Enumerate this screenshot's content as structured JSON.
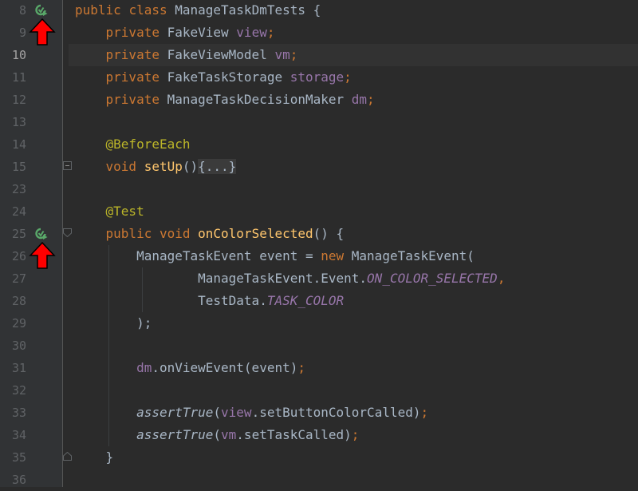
{
  "editor": {
    "lines": [
      {
        "num": "8",
        "tokens": [
          {
            "t": "public ",
            "c": "kw"
          },
          {
            "t": "class ",
            "c": "kw"
          },
          {
            "t": "ManageTaskDmTests {",
            "c": ""
          }
        ]
      },
      {
        "num": "9",
        "tokens": [
          {
            "t": "    ",
            "c": ""
          },
          {
            "t": "private ",
            "c": "kw"
          },
          {
            "t": "FakeView ",
            "c": ""
          },
          {
            "t": "view",
            "c": "fld"
          },
          {
            "t": ";",
            "c": "kw"
          }
        ]
      },
      {
        "num": "10",
        "tokens": [
          {
            "t": "    ",
            "c": ""
          },
          {
            "t": "private ",
            "c": "kw"
          },
          {
            "t": "FakeViewModel ",
            "c": ""
          },
          {
            "t": "vm",
            "c": "fld"
          },
          {
            "t": ";",
            "c": "kw"
          }
        ]
      },
      {
        "num": "11",
        "tokens": [
          {
            "t": "    ",
            "c": ""
          },
          {
            "t": "private ",
            "c": "kw"
          },
          {
            "t": "FakeTaskStorage ",
            "c": ""
          },
          {
            "t": "storage",
            "c": "fld"
          },
          {
            "t": ";",
            "c": "kw"
          }
        ]
      },
      {
        "num": "12",
        "tokens": [
          {
            "t": "    ",
            "c": ""
          },
          {
            "t": "private ",
            "c": "kw"
          },
          {
            "t": "ManageTaskDecisionMaker ",
            "c": ""
          },
          {
            "t": "dm",
            "c": "fld"
          },
          {
            "t": ";",
            "c": "kw"
          }
        ]
      },
      {
        "num": "13",
        "tokens": []
      },
      {
        "num": "14",
        "tokens": [
          {
            "t": "    ",
            "c": ""
          },
          {
            "t": "@BeforeEach",
            "c": "ann"
          }
        ]
      },
      {
        "num": "15",
        "tokens": [
          {
            "t": "    ",
            "c": ""
          },
          {
            "t": "void ",
            "c": "kw"
          },
          {
            "t": "setUp",
            "c": "fn"
          },
          {
            "t": "()",
            "c": ""
          },
          {
            "t": "{...}",
            "c": "fold-text"
          }
        ]
      },
      {
        "num": "23",
        "tokens": []
      },
      {
        "num": "24",
        "tokens": [
          {
            "t": "    ",
            "c": ""
          },
          {
            "t": "@Test",
            "c": "ann"
          }
        ]
      },
      {
        "num": "25",
        "tokens": [
          {
            "t": "    ",
            "c": ""
          },
          {
            "t": "public ",
            "c": "kw"
          },
          {
            "t": "void ",
            "c": "kw"
          },
          {
            "t": "onColorSelected",
            "c": "fn"
          },
          {
            "t": "() {",
            "c": ""
          }
        ]
      },
      {
        "num": "26",
        "tokens": [
          {
            "t": "        ManageTaskEvent event = ",
            "c": ""
          },
          {
            "t": "new ",
            "c": "kw"
          },
          {
            "t": "ManageTaskEvent(",
            "c": ""
          }
        ]
      },
      {
        "num": "27",
        "tokens": [
          {
            "t": "                ManageTaskEvent.Event.",
            "c": ""
          },
          {
            "t": "ON_COLOR_SELECTED",
            "c": "stat"
          },
          {
            "t": ",",
            "c": "kw"
          }
        ]
      },
      {
        "num": "28",
        "tokens": [
          {
            "t": "                TestData.",
            "c": ""
          },
          {
            "t": "TASK_COLOR",
            "c": "stat"
          }
        ]
      },
      {
        "num": "29",
        "tokens": [
          {
            "t": "        );",
            "c": ""
          }
        ]
      },
      {
        "num": "30",
        "tokens": []
      },
      {
        "num": "31",
        "tokens": [
          {
            "t": "        ",
            "c": ""
          },
          {
            "t": "dm",
            "c": "fld"
          },
          {
            "t": ".onViewEvent(event)",
            "c": ""
          },
          {
            "t": ";",
            "c": "kw"
          }
        ]
      },
      {
        "num": "32",
        "tokens": []
      },
      {
        "num": "33",
        "tokens": [
          {
            "t": "        ",
            "c": ""
          },
          {
            "t": "assertTrue",
            "c": "it"
          },
          {
            "t": "(",
            "c": ""
          },
          {
            "t": "view",
            "c": "fld"
          },
          {
            "t": ".setButtonColorCalled)",
            "c": ""
          },
          {
            "t": ";",
            "c": "kw"
          }
        ]
      },
      {
        "num": "34",
        "tokens": [
          {
            "t": "        ",
            "c": ""
          },
          {
            "t": "assertTrue",
            "c": "it"
          },
          {
            "t": "(",
            "c": ""
          },
          {
            "t": "vm",
            "c": "fld"
          },
          {
            "t": ".setTaskCalled)",
            "c": ""
          },
          {
            "t": ";",
            "c": "kw"
          }
        ]
      },
      {
        "num": "35",
        "tokens": [
          {
            "t": "    }",
            "c": ""
          }
        ]
      },
      {
        "num": "36",
        "tokens": []
      }
    ],
    "current_line": "10",
    "run_icon_lines": [
      "8",
      "25"
    ],
    "arrow_lines": [
      "9",
      "26"
    ],
    "fold_lines": [
      "15",
      "25",
      "35"
    ]
  },
  "colors": {
    "background": "#2b2b2b",
    "gutter": "#313335",
    "keyword": "#cc7832",
    "field": "#9876aa",
    "method": "#ffc66d",
    "annotation": "#bbb529",
    "text": "#a9b7c6",
    "line_number": "#606366",
    "run_icon": "#59a869",
    "arrow": "#ff0000"
  },
  "icons": {
    "run": "run-test-icon",
    "arrow": "red-up-arrow-icon",
    "fold": "fold-toggle-icon"
  }
}
